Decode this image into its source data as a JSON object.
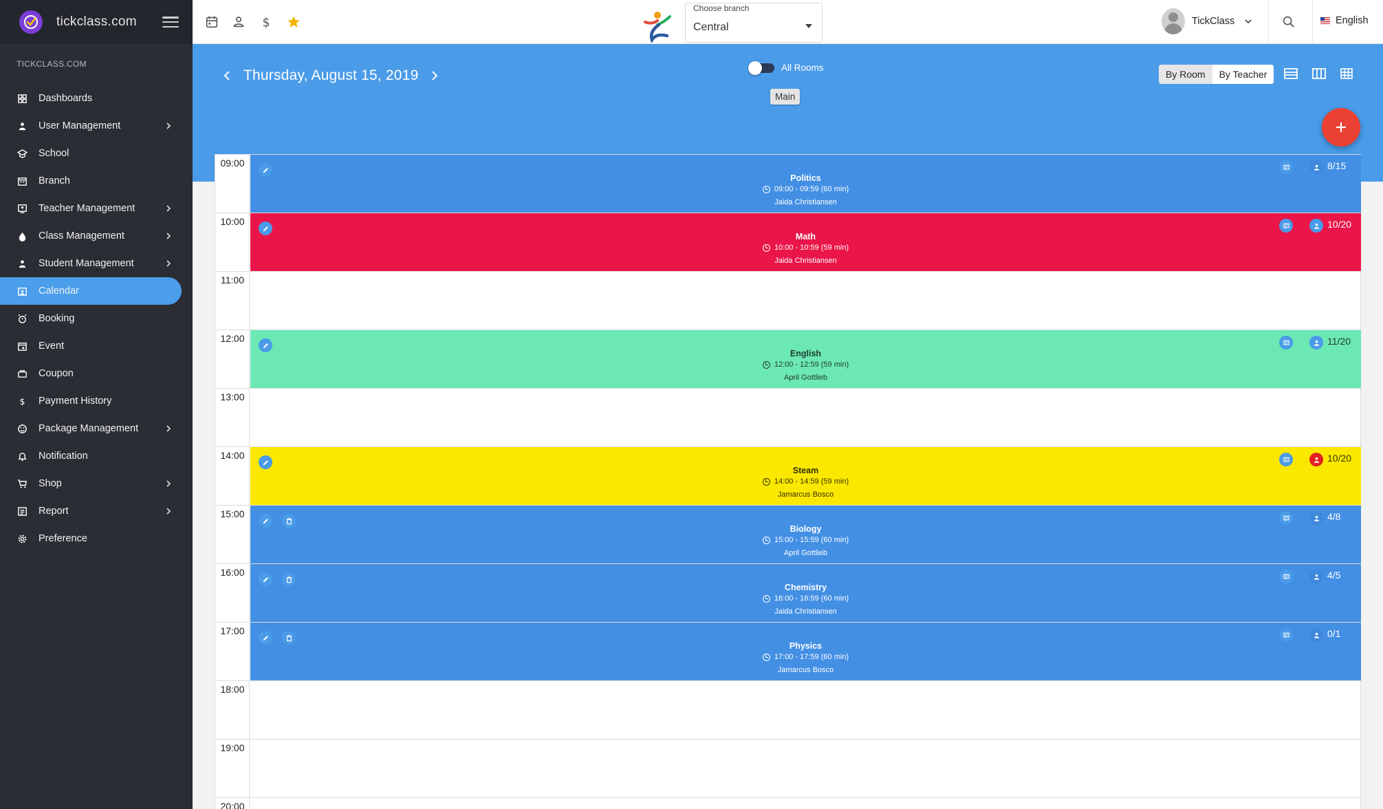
{
  "sidebar": {
    "brand": "tickclass.com",
    "section_label": "TICKCLASS.COM",
    "items": [
      {
        "label": "Dashboards",
        "icon": "dashboard-icon",
        "chevron": false,
        "active": false
      },
      {
        "label": "User Management",
        "icon": "user-icon",
        "chevron": true,
        "active": false
      },
      {
        "label": "School",
        "icon": "school-icon",
        "chevron": false,
        "active": false
      },
      {
        "label": "Branch",
        "icon": "branch-icon",
        "chevron": false,
        "active": false
      },
      {
        "label": "Teacher Management",
        "icon": "teacher-icon",
        "chevron": true,
        "active": false
      },
      {
        "label": "Class Management",
        "icon": "class-icon",
        "chevron": true,
        "active": false
      },
      {
        "label": "Student Management",
        "icon": "student-icon",
        "chevron": true,
        "active": false
      },
      {
        "label": "Calendar",
        "icon": "calendar-icon",
        "chevron": false,
        "active": true
      },
      {
        "label": "Booking",
        "icon": "alarm-icon",
        "chevron": false,
        "active": false
      },
      {
        "label": "Event",
        "icon": "event-icon",
        "chevron": false,
        "active": false
      },
      {
        "label": "Coupon",
        "icon": "coupon-icon",
        "chevron": false,
        "active": false
      },
      {
        "label": "Payment History",
        "icon": "dollar-icon",
        "chevron": false,
        "active": false
      },
      {
        "label": "Package Management",
        "icon": "package-icon",
        "chevron": true,
        "active": false
      },
      {
        "label": "Notification",
        "icon": "bell-icon",
        "chevron": false,
        "active": false
      },
      {
        "label": "Shop",
        "icon": "cart-icon",
        "chevron": true,
        "active": false
      },
      {
        "label": "Report",
        "icon": "report-icon",
        "chevron": true,
        "active": false
      },
      {
        "label": "Preference",
        "icon": "gear-icon",
        "chevron": false,
        "active": false
      }
    ]
  },
  "topbar": {
    "branch_label": "Choose branch",
    "branch_value": "Central",
    "user_name": "TickClass",
    "language": "English"
  },
  "header": {
    "date": "Thursday, August 15, 2019",
    "rooms_toggle_label": "All Rooms",
    "room_chip": "Main",
    "view_by_room": "By Room",
    "view_by_teacher": "By Teacher",
    "fab_label": "+"
  },
  "calendar": {
    "times": [
      "09:00",
      "10:00",
      "11:00",
      "12:00",
      "13:00",
      "14:00",
      "15:00",
      "16:00",
      "17:00",
      "18:00",
      "19:00",
      "20:00"
    ],
    "events": [
      {
        "slot": 0,
        "title": "Politics",
        "time": "09:00 - 09:59 (60 min)",
        "teacher": "Jaida Christiansen",
        "count": "8/15",
        "bg": "#438fe4",
        "fg": "#ffffff",
        "delete": false,
        "att_color": "#3f88db"
      },
      {
        "slot": 1,
        "title": "Math",
        "time": "10:00 - 10:59 (59 min)",
        "teacher": "Jaida Christiansen",
        "count": "10/20",
        "bg": "#ea1549",
        "fg": "#ffffff",
        "delete": false,
        "att_color": "#4a9be8"
      },
      {
        "slot": 3,
        "title": "English",
        "time": "12:00 - 12:59 (59 min)",
        "teacher": "April Gottlieb",
        "count": "11/20",
        "bg": "#6ce8b5",
        "fg": "#1f3a2e",
        "delete": false,
        "att_color": "#4a9be8"
      },
      {
        "slot": 5,
        "title": "Steam",
        "time": "14:00 - 14:59 (59 min)",
        "teacher": "Jamarcus Bosco",
        "count": "10/20",
        "bg": "#fbe800",
        "fg": "#333300",
        "delete": false,
        "att_color": "#e22222"
      },
      {
        "slot": 6,
        "title": "Biology",
        "time": "15:00 - 15:59 (60 min)",
        "teacher": "April Gottlieb",
        "count": "4/8",
        "bg": "#438fe4",
        "fg": "#ffffff",
        "delete": true,
        "att_color": "#3f88db"
      },
      {
        "slot": 7,
        "title": "Chemistry",
        "time": "16:00 - 16:59 (60 min)",
        "teacher": "Jaida Christiansen",
        "count": "4/5",
        "bg": "#438fe4",
        "fg": "#ffffff",
        "delete": true,
        "att_color": "#3f88db"
      },
      {
        "slot": 8,
        "title": "Physics",
        "time": "17:00 - 17:59 (60 min)",
        "teacher": "Jamarcus Bosco",
        "count": "0/1",
        "bg": "#438fe4",
        "fg": "#ffffff",
        "delete": true,
        "att_color": "#3f88db"
      }
    ]
  },
  "colors": {
    "accent": "#4a9be8",
    "sidebar_bg": "#2b2d35",
    "fab": "#ea4134"
  }
}
